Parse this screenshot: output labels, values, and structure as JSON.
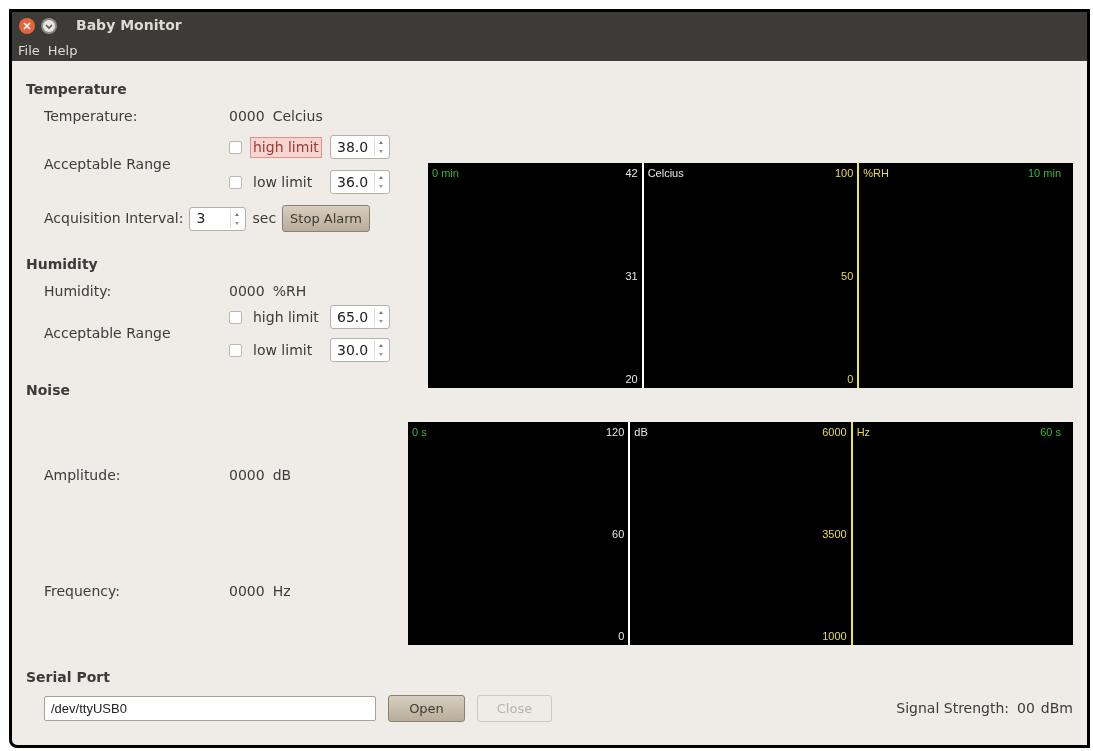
{
  "window": {
    "title": "Baby Monitor"
  },
  "menu": [
    "File",
    "Help"
  ],
  "temperature": {
    "heading": "Temperature",
    "reading_label": "Temperature:",
    "reading": "0000",
    "unit": "Celcius",
    "range_label": "Acceptable Range",
    "limits": [
      {
        "label": "high limit",
        "checked": false,
        "alarm": true,
        "value": "38.0"
      },
      {
        "label": "low limit",
        "checked": false,
        "alarm": false,
        "value": "36.0"
      }
    ],
    "interval_label": "Acquisition Interval:",
    "interval": "3",
    "interval_unit": "sec",
    "stop_button": "Stop Alarm"
  },
  "humidity": {
    "heading": "Humidity",
    "reading_label": "Humidity:",
    "reading": "0000",
    "unit": "%RH",
    "range_label": "Acceptable Range",
    "limits": [
      {
        "label": "high limit",
        "checked": false,
        "alarm": false,
        "value": "65.0"
      },
      {
        "label": "low limit",
        "checked": false,
        "alarm": false,
        "value": "30.0"
      }
    ]
  },
  "climate_plot": {
    "time_start": "0 min",
    "left_ticks": [
      "42",
      "31",
      "20"
    ],
    "left_unit": "Celcius",
    "right_ticks": [
      "100",
      "50",
      "0"
    ],
    "right_unit": "%RH",
    "time_end": "10 min"
  },
  "noise": {
    "heading": "Noise",
    "amplitude_label": "Amplitude:",
    "amplitude": "0000",
    "amplitude_unit": "dB",
    "frequency_label": "Frequency:",
    "frequency": "0000",
    "frequency_unit": "Hz"
  },
  "noise_plot": {
    "time_start": "0 s",
    "left_ticks": [
      "120",
      "60",
      "0"
    ],
    "left_unit": "dB",
    "right_ticks": [
      "6000",
      "3500",
      "1000"
    ],
    "right_unit": "Hz",
    "time_end": "60 s"
  },
  "serial_port": {
    "heading": "Serial Port",
    "device": "/dev/ttyUSB0",
    "buttons": [
      {
        "label": "Open",
        "disabled": false
      },
      {
        "label": "Close",
        "disabled": true
      }
    ],
    "signal_label": "Signal Strength:",
    "signal": "00",
    "signal_unit": "dBm"
  }
}
